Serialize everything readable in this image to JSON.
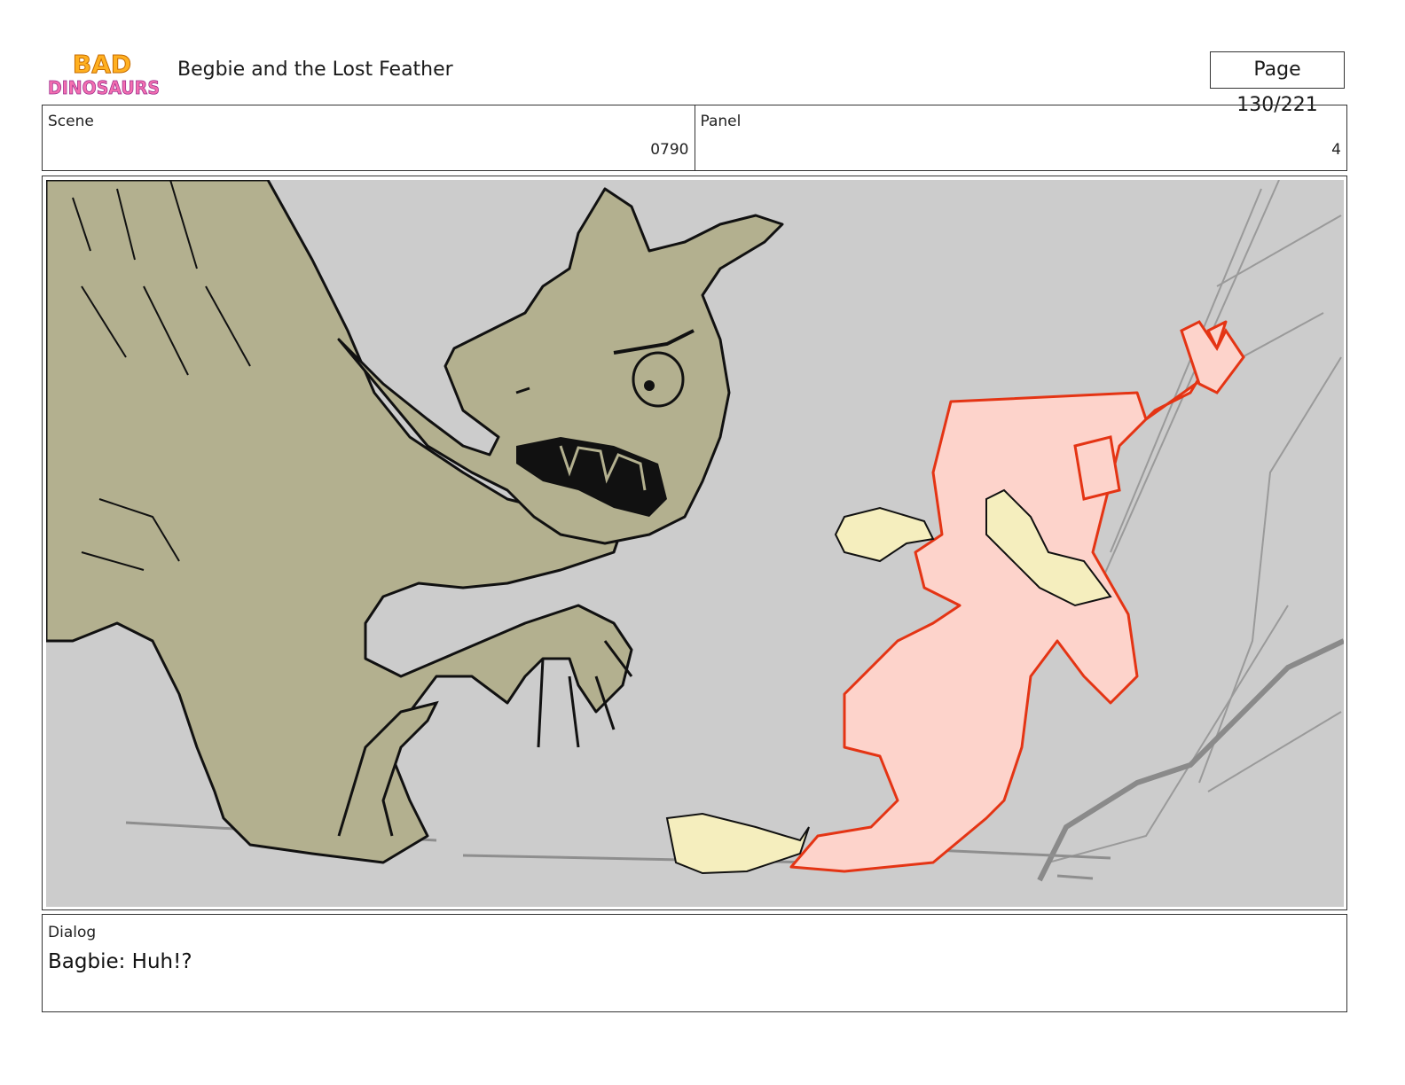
{
  "header": {
    "logo_text_top": "BAD",
    "logo_text_bottom": "DINOSAURS",
    "title": "Begbie and the Lost Feather",
    "page": "Page 130/221"
  },
  "meta": {
    "scene_label": "Scene",
    "scene_value": "0790",
    "panel_label": "Panel",
    "panel_value": "4"
  },
  "dialog": {
    "label": "Dialog",
    "text": "Bagbie: Huh!?"
  },
  "colors": {
    "background": "#cccccc",
    "dino": "#b3b08f",
    "dino_outline": "#111111",
    "bagbie_fill": "#fdd3cb",
    "bagbie_outline": "#e43414",
    "feather": "#f5eebe"
  }
}
